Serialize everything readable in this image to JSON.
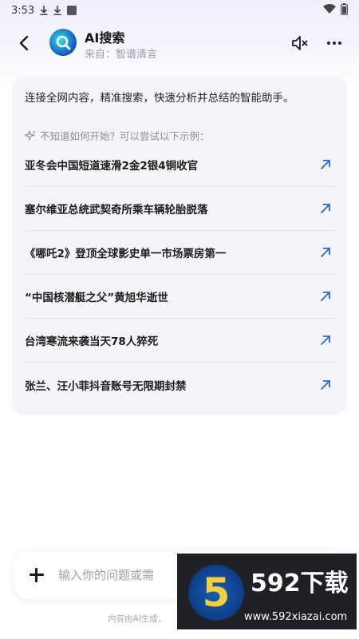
{
  "status_bar": {
    "time": "3:53"
  },
  "header": {
    "title": "AI搜索",
    "subtitle": "来自：智谱清言"
  },
  "card": {
    "intro": "连接全网内容，精准搜索，快速分析并总结的智能助手。",
    "hint": "不知道如何开始？可以尝试以下示例：",
    "suggestions": [
      "亚冬会中国短道速滑2金2银4铜收官",
      "塞尔维亚总统武契奇所乘车辆轮胎脱落",
      "《哪吒2》登顶全球影史单一市场票房第一",
      "“中国核潜艇之父”黄旭华逝世",
      "台湾寒流来袭当天78人猝死",
      "张兰、汪小菲抖音账号无限期封禁"
    ]
  },
  "input": {
    "placeholder": "输入你的问题或需"
  },
  "disclaimer": "内容由AI生成，",
  "watermark": {
    "brand": "592下载",
    "url": "www.592xiazai.com",
    "logo_digit": "5"
  },
  "colors": {
    "accent": "#2a66d9",
    "card_bg": "#f4f5f9",
    "watermark_bg": "#1f2126",
    "watermark_gold": "#f4d03f"
  },
  "icons": [
    "download-icon",
    "download-icon",
    "app-square-icon",
    "wifi-icon",
    "battery-icon",
    "back-icon",
    "search-logo-icon",
    "mute-icon",
    "more-icon",
    "sparkle-icon",
    "arrow-up-right-icon",
    "plus-icon"
  ]
}
